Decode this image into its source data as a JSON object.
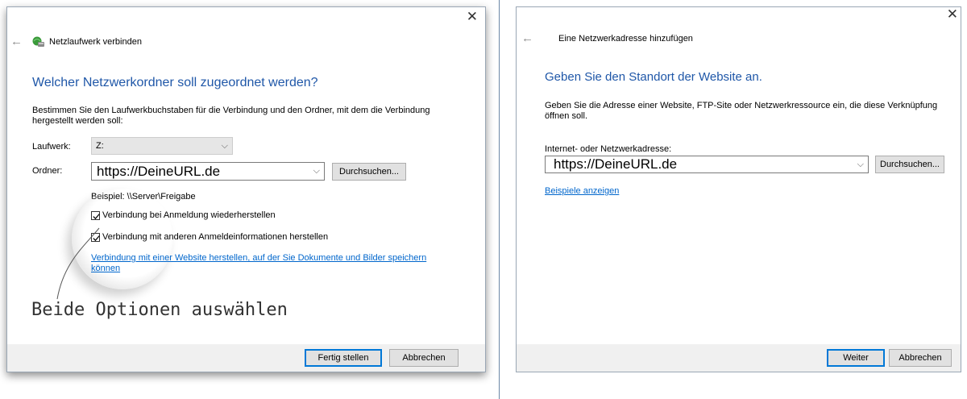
{
  "left_dialog": {
    "title": "Netzlaufwerk verbinden",
    "close_glyph": "✕",
    "heading": "Welcher Netzwerkordner soll zugeordnet werden?",
    "description": "Bestimmen Sie den Laufwerkbuchstaben für die Verbindung und den Ordner, mit dem die Verbindung hergestellt werden soll:",
    "drive_label": "Laufwerk:",
    "drive_value": "Z:",
    "folder_label": "Ordner:",
    "folder_value": "https://DeineURL.de",
    "browse_label": "Durchsuchen...",
    "example_text": "Beispiel: \\\\Server\\Freigabe",
    "checkbox1_label": "Verbindung bei Anmeldung wiederherstellen",
    "checkbox1_checked": true,
    "checkbox2_label": "Verbindung mit anderen Anmeldeinformationen herstellen",
    "checkbox2_checked": true,
    "link_text": "Verbindung mit einer Website herstellen, auf der Sie Dokumente und Bilder speichern können",
    "finish_label": "Fertig stellen",
    "cancel_label": "Abbrechen",
    "annotation": "Beide Optionen auswählen"
  },
  "right_dialog": {
    "title": "Eine Netzwerkadresse hinzufügen",
    "close_glyph": "✕",
    "heading": "Geben Sie den Standort der Website an.",
    "description": "Geben Sie die Adresse einer Website, FTP-Site oder Netzwerkressource ein, die diese Verknüpfung öffnen soll.",
    "address_label": "Internet- oder Netzwerkadresse:",
    "address_value": "https://DeineURL.de",
    "browse_label": "Durchsuchen...",
    "examples_link": "Beispiele anzeigen",
    "next_label": "Weiter",
    "cancel_label": "Abbrechen"
  },
  "icons": {
    "back": "back-arrow-icon",
    "network_drive": "network-drive-icon",
    "chevron": "chevron-down-icon",
    "close": "close-icon"
  },
  "colors": {
    "heading": "#1f57a8",
    "link": "#0066cc",
    "default_button_border": "#0078d7",
    "footer": "#f0f0f0"
  }
}
